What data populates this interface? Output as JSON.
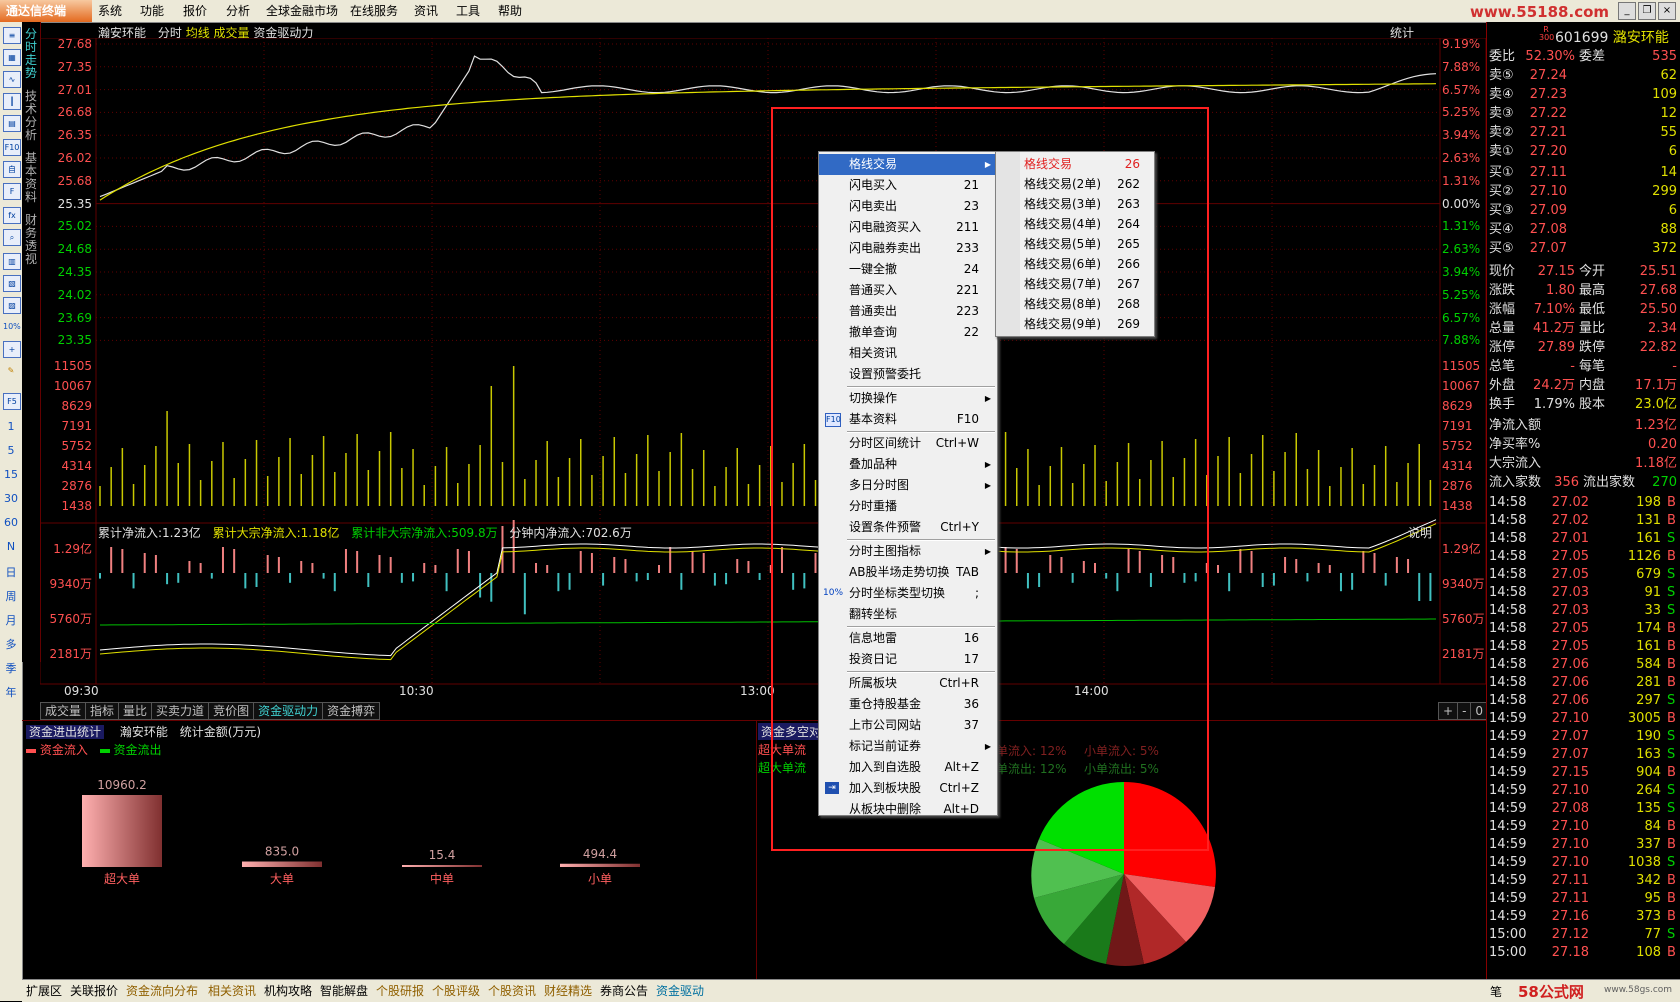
{
  "app": {
    "logo": "通达信终端",
    "menu": [
      "系统",
      "功能",
      "报价",
      "分析",
      "全球金融市场",
      "在线服务",
      "资讯",
      "工具",
      "帮助"
    ],
    "watermark": "www.55188.com"
  },
  "vtabs": [
    "分时走势",
    "技术分析",
    "基本资料",
    "财务透视"
  ],
  "left_toolbar_nums": [
    "1",
    "5",
    "15",
    "30",
    "60",
    "N",
    "日",
    "周",
    "月",
    "多",
    "季",
    "年"
  ],
  "chart_header": {
    "name": "瀚安环能",
    "mode": "分时",
    "avg": "均线",
    "vol": "成交量",
    "driver": "资金驱动力",
    "stat": "统计"
  },
  "price_axis": {
    "left": [
      "27.68",
      "27.35",
      "27.01",
      "26.68",
      "26.35",
      "26.02",
      "25.68",
      "25.35",
      "25.02",
      "24.68",
      "24.35",
      "24.02",
      "23.69",
      "23.35"
    ],
    "right": [
      "9.19%",
      "7.88%",
      "6.57%",
      "5.25%",
      "3.94%",
      "2.63%",
      "1.31%",
      "0.00%",
      "1.31%",
      "2.63%",
      "3.94%",
      "5.25%",
      "6.57%",
      "7.88%"
    ]
  },
  "volume_axis": [
    "11505",
    "10067",
    "8629",
    "7191",
    "5752",
    "4314",
    "2876",
    "1438"
  ],
  "flow_header": {
    "cum": "累计净流入:1.23亿",
    "block": "累计大宗净流入:1.18亿",
    "nonblock": "累计非大宗净流入:509.8万",
    "minute": "分钟内净流入:702.6万",
    "explain": "说明"
  },
  "flow_axis": [
    "1.29亿",
    "9340万",
    "5760万",
    "2181万"
  ],
  "time_axis": [
    "09:30",
    "10:30",
    "13:00",
    "14:00"
  ],
  "bottom_tabs": [
    "成交量",
    "指标",
    "量比",
    "买卖力道",
    "竞价图",
    "资金驱动力",
    "资金搏弈"
  ],
  "bottom_tab_active": "资金驱动力",
  "fund_panel": {
    "title": "资金进出统计",
    "stock": "瀚安环能",
    "unit": "统计金额(万元)",
    "legend_in": "资金流入",
    "legend_out": "资金流出",
    "right_title": "资金多空对",
    "right_legend": [
      "超大单流",
      "超大单流"
    ],
    "pie_labels": [
      "单流入: 12%",
      "小单流入: 5%",
      "单流出: 12%",
      "小单流出: 5%"
    ]
  },
  "chart_data": {
    "type": "bar",
    "title": "资金进出统计",
    "categories": [
      "超大单",
      "大单",
      "中单",
      "小单"
    ],
    "values": [
      10960.2,
      835.0,
      15.4,
      494.4
    ]
  },
  "context_menu": {
    "items": [
      {
        "label": "格线交易",
        "key": "",
        "sub": true
      },
      {
        "label": "闪电买入",
        "key": "21"
      },
      {
        "label": "闪电卖出",
        "key": "23"
      },
      {
        "label": "闪电融资买入",
        "key": "211"
      },
      {
        "label": "闪电融券卖出",
        "key": "233"
      },
      {
        "label": "一键全撤",
        "key": "24"
      },
      {
        "label": "普通买入",
        "key": "221"
      },
      {
        "label": "普通卖出",
        "key": "223"
      },
      {
        "label": "撤单查询",
        "key": "22"
      },
      {
        "label": "相关资讯",
        "key": ""
      },
      {
        "label": "设置预警委托",
        "key": ""
      },
      {
        "label": "切换操作",
        "key": "",
        "sub": true
      },
      {
        "label": "基本资料",
        "key": "F10"
      },
      {
        "label": "分时区间统计",
        "key": "Ctrl+W"
      },
      {
        "label": "叠加品种",
        "key": "",
        "sub": true
      },
      {
        "label": "多日分时图",
        "key": "",
        "sub": true
      },
      {
        "label": "分时重播",
        "key": ""
      },
      {
        "label": "设置条件预警",
        "key": "Ctrl+Y"
      },
      {
        "label": "分时主图指标",
        "key": "",
        "sub": true
      },
      {
        "label": "AB股半场走势切换",
        "key": "TAB"
      },
      {
        "label": "分时坐标类型切换",
        "key": ";"
      },
      {
        "label": "翻转坐标",
        "key": ""
      },
      {
        "label": "信息地雷",
        "key": "16"
      },
      {
        "label": "投资日记",
        "key": "17"
      },
      {
        "label": "所属板块",
        "key": "Ctrl+R"
      },
      {
        "label": "重仓持股基金",
        "key": "36"
      },
      {
        "label": "上市公司网站",
        "key": "37"
      },
      {
        "label": "标记当前证券",
        "key": "",
        "sub": true
      },
      {
        "label": "加入到自选股",
        "key": "Alt+Z"
      },
      {
        "label": "加入到板块股",
        "key": "Ctrl+Z"
      },
      {
        "label": "从板块中删除",
        "key": "Alt+D"
      }
    ],
    "submenu": [
      {
        "label": "格线交易",
        "key": "26"
      },
      {
        "label": "格线交易(2单)",
        "key": "262"
      },
      {
        "label": "格线交易(3单)",
        "key": "263"
      },
      {
        "label": "格线交易(4单)",
        "key": "264"
      },
      {
        "label": "格线交易(5单)",
        "key": "265"
      },
      {
        "label": "格线交易(6单)",
        "key": "266"
      },
      {
        "label": "格线交易(7单)",
        "key": "267"
      },
      {
        "label": "格线交易(8单)",
        "key": "268"
      },
      {
        "label": "格线交易(9单)",
        "key": "269"
      }
    ]
  },
  "quote": {
    "code": "601699",
    "name": "潞安环能",
    "badge": "R 300",
    "weibi_label": "委比",
    "weibi": "52.30%",
    "weicha_label": "委差",
    "weicha": "535",
    "asks": [
      {
        "l": "卖⑤",
        "p": "27.24",
        "v": "62"
      },
      {
        "l": "卖④",
        "p": "27.23",
        "v": "109"
      },
      {
        "l": "卖③",
        "p": "27.22",
        "v": "12"
      },
      {
        "l": "卖②",
        "p": "27.21",
        "v": "55"
      },
      {
        "l": "卖①",
        "p": "27.20",
        "v": "6"
      }
    ],
    "bids": [
      {
        "l": "买①",
        "p": "27.11",
        "v": "14"
      },
      {
        "l": "买②",
        "p": "27.10",
        "v": "299"
      },
      {
        "l": "买③",
        "p": "27.09",
        "v": "6"
      },
      {
        "l": "买④",
        "p": "27.08",
        "v": "88"
      },
      {
        "l": "买⑤",
        "p": "27.07",
        "v": "372"
      }
    ],
    "stats": [
      {
        "a": "现价",
        "av": "27.15",
        "b": "今开",
        "bv": "25.51"
      },
      {
        "a": "涨跌",
        "av": "1.80",
        "b": "最高",
        "bv": "27.68"
      },
      {
        "a": "涨幅",
        "av": "7.10%",
        "b": "最低",
        "bv": "25.50"
      },
      {
        "a": "总量",
        "av": "41.2万",
        "b": "量比",
        "bv": "2.34"
      },
      {
        "a": "涨停",
        "av": "27.89",
        "b": "跌停",
        "bv": "22.82"
      },
      {
        "a": "总笔",
        "av": "-",
        "b": "每笔",
        "bv": "-"
      },
      {
        "a": "外盘",
        "av": "24.2万",
        "b": "内盘",
        "bv": "17.1万"
      },
      {
        "a": "换手",
        "av": "1.79%",
        "b": "股本",
        "bv": "23.0亿"
      }
    ],
    "flows": [
      {
        "a": "净流入额",
        "v": "1.23亿"
      },
      {
        "a": "净买率%",
        "v": "0.20"
      },
      {
        "a": "大宗流入",
        "v": "1.18亿"
      }
    ],
    "flow_count": {
      "a": "流入家数",
      "av": "356",
      "b": "流出家数",
      "bv": "270"
    },
    "ticks": [
      {
        "t": "14:58",
        "p": "27.02",
        "v": "198",
        "s": "B"
      },
      {
        "t": "14:58",
        "p": "27.02",
        "v": "131",
        "s": "B"
      },
      {
        "t": "14:58",
        "p": "27.01",
        "v": "161",
        "s": "S"
      },
      {
        "t": "14:58",
        "p": "27.05",
        "v": "1126",
        "s": "B"
      },
      {
        "t": "14:58",
        "p": "27.05",
        "v": "679",
        "s": "S"
      },
      {
        "t": "14:58",
        "p": "27.03",
        "v": "91",
        "s": "S"
      },
      {
        "t": "14:58",
        "p": "27.03",
        "v": "33",
        "s": "S"
      },
      {
        "t": "14:58",
        "p": "27.05",
        "v": "174",
        "s": "B"
      },
      {
        "t": "14:58",
        "p": "27.05",
        "v": "161",
        "s": "B"
      },
      {
        "t": "14:58",
        "p": "27.06",
        "v": "584",
        "s": "B"
      },
      {
        "t": "14:58",
        "p": "27.06",
        "v": "281",
        "s": "B"
      },
      {
        "t": "14:58",
        "p": "27.06",
        "v": "297",
        "s": "S"
      },
      {
        "t": "14:59",
        "p": "27.10",
        "v": "3005",
        "s": "B"
      },
      {
        "t": "14:59",
        "p": "27.07",
        "v": "190",
        "s": "S"
      },
      {
        "t": "14:59",
        "p": "27.07",
        "v": "163",
        "s": "S"
      },
      {
        "t": "14:59",
        "p": "27.15",
        "v": "904",
        "s": "B"
      },
      {
        "t": "14:59",
        "p": "27.10",
        "v": "264",
        "s": "S"
      },
      {
        "t": "14:59",
        "p": "27.08",
        "v": "135",
        "s": "S"
      },
      {
        "t": "14:59",
        "p": "27.10",
        "v": "84",
        "s": "B"
      },
      {
        "t": "14:59",
        "p": "27.10",
        "v": "337",
        "s": "B"
      },
      {
        "t": "14:59",
        "p": "27.10",
        "v": "1038",
        "s": "S"
      },
      {
        "t": "14:59",
        "p": "27.11",
        "v": "342",
        "s": "B"
      },
      {
        "t": "14:59",
        "p": "27.11",
        "v": "95",
        "s": "B"
      },
      {
        "t": "14:59",
        "p": "27.16",
        "v": "373",
        "s": "B"
      },
      {
        "t": "15:00",
        "p": "27.12",
        "v": "77",
        "s": "S"
      },
      {
        "t": "15:00",
        "p": "27.18",
        "v": "108",
        "s": "B"
      }
    ],
    "bottom_label": "笔"
  },
  "status_tabs": [
    "扩展区",
    "关联报价",
    "资金流向分布",
    "相关资讯",
    "机构攻略",
    "智能解盘",
    "个股研报",
    "个股评级",
    "个股资讯",
    "财经精选",
    "券商公告",
    "资金驱动"
  ],
  "footer_brand": "58公式网",
  "footer_url": "www.58gs.com",
  "colors": {
    "up": "#ff5050",
    "down": "#00d000",
    "price_line": "#e0e0e0",
    "avg_line": "#e0e000",
    "grid": "#600000"
  }
}
